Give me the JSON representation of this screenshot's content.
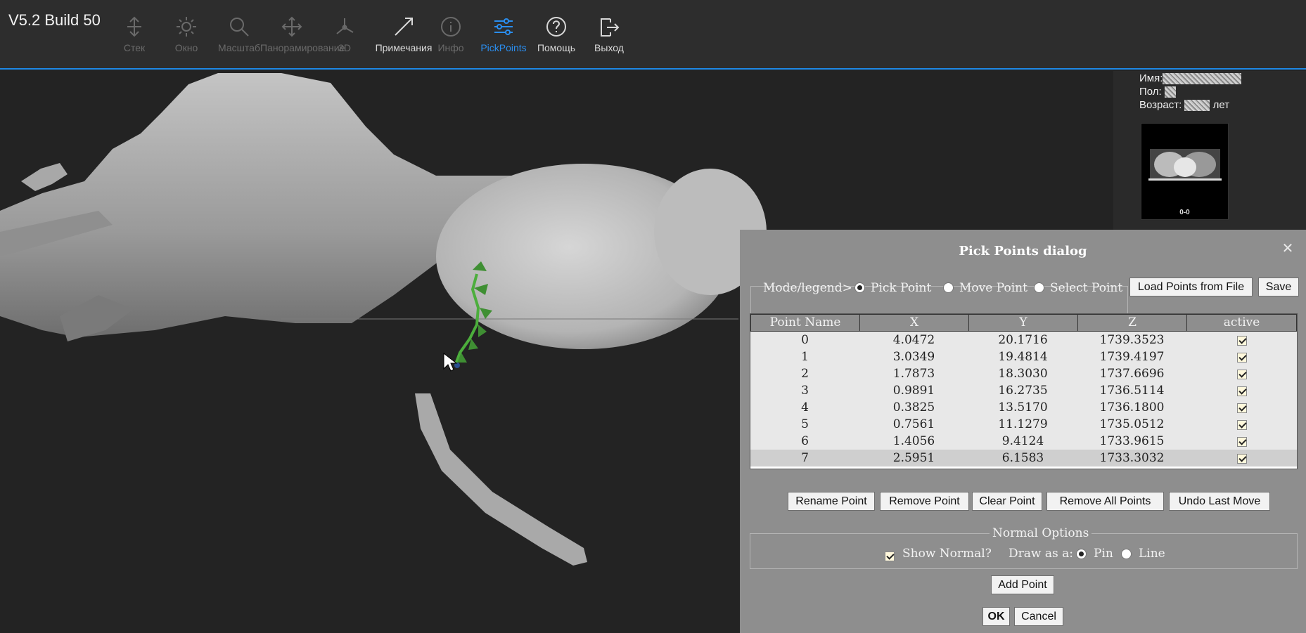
{
  "app": {
    "version": "V5.2 Build 50"
  },
  "toolbar": {
    "tools": [
      {
        "label": "Стек",
        "icon": "stack-arrows-icon"
      },
      {
        "label": "Окно",
        "icon": "sun-icon"
      },
      {
        "label": "Масштаб",
        "icon": "magnifier-icon"
      },
      {
        "label": "Панорамирование",
        "icon": "pan-cross-icon"
      },
      {
        "label": "3D",
        "icon": "axes-3d-icon"
      },
      {
        "label": "Примечания",
        "icon": "diagonal-arrow-icon"
      },
      {
        "label": "Инфо",
        "icon": "info-circle-icon"
      },
      {
        "label": "PickPoints",
        "icon": "sliders-icon"
      },
      {
        "label": "Помощь",
        "icon": "question-circle-icon"
      },
      {
        "label": "Выход",
        "icon": "exit-door-icon"
      }
    ],
    "selected": "PickPoints",
    "accent_color": "#2a8ef0"
  },
  "patient": {
    "name_label": "Имя:",
    "sex_label": "Пол:",
    "age_label": "Возраст:",
    "age_unit": "лет",
    "thumbnail_label": "0-0"
  },
  "dialog": {
    "title": "Pick Points dialog",
    "mode_label": "Mode/legend>",
    "modes": [
      {
        "label": "Pick Point",
        "selected": true
      },
      {
        "label": "Move Point",
        "selected": false
      },
      {
        "label": "Select Point",
        "selected": false
      }
    ],
    "load_button": "Load Points from File",
    "save_button": "Save",
    "columns": [
      "Point Name",
      "X",
      "Y",
      "Z",
      "active"
    ],
    "points": [
      {
        "name": "0",
        "x": "4.0472",
        "y": "20.1716",
        "z": "1739.3523",
        "active": true
      },
      {
        "name": "1",
        "x": "3.0349",
        "y": "19.4814",
        "z": "1739.4197",
        "active": true
      },
      {
        "name": "2",
        "x": "1.7873",
        "y": "18.3030",
        "z": "1737.6696",
        "active": true
      },
      {
        "name": "3",
        "x": "0.9891",
        "y": "16.2735",
        "z": "1736.5114",
        "active": true
      },
      {
        "name": "4",
        "x": "0.3825",
        "y": "13.5170",
        "z": "1736.1800",
        "active": true
      },
      {
        "name": "5",
        "x": "0.7561",
        "y": "11.1279",
        "z": "1735.0512",
        "active": true
      },
      {
        "name": "6",
        "x": "1.4056",
        "y": "9.4124",
        "z": "1733.9615",
        "active": true
      },
      {
        "name": "7",
        "x": "2.5951",
        "y": "6.1583",
        "z": "1733.3032",
        "active": true
      }
    ],
    "selected_row": "7",
    "actions": {
      "rename": "Rename Point",
      "remove": "Remove Point",
      "clear": "Clear Point",
      "remove_all": "Remove All Points",
      "undo": "Undo Last Move"
    },
    "normal_options": {
      "title": "Normal Options",
      "show_normal_label": "Show Normal?",
      "show_normal_checked": true,
      "draw_as_label": "Draw as a:",
      "draw_options": [
        {
          "label": "Pin",
          "selected": true
        },
        {
          "label": "Line",
          "selected": false
        }
      ]
    },
    "add_point_button": "Add Point",
    "ok_button": "OK",
    "cancel_button": "Cancel"
  }
}
